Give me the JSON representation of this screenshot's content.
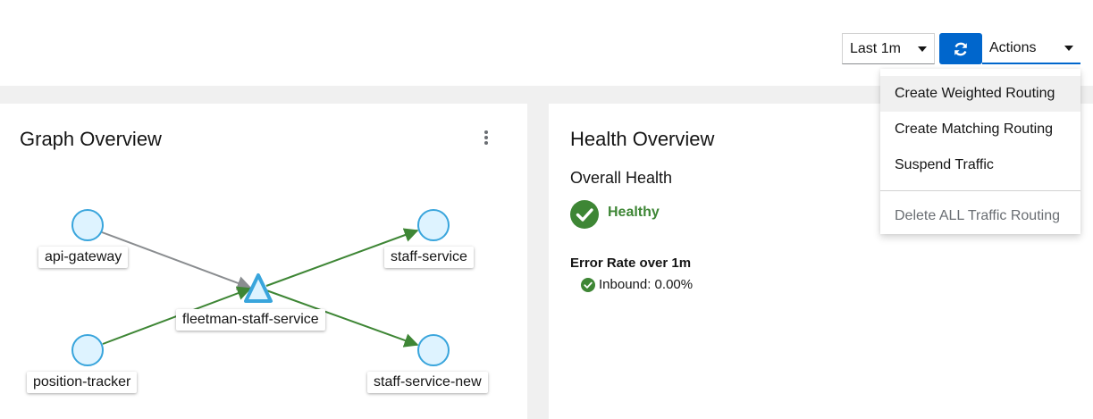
{
  "toolbar": {
    "time_range": "Last 1m",
    "actions_label": "Actions"
  },
  "actions_menu": {
    "items": [
      {
        "label": "Create Weighted Routing"
      },
      {
        "label": "Create Matching Routing"
      },
      {
        "label": "Suspend Traffic"
      },
      {
        "label": "Delete ALL Traffic Routing"
      }
    ]
  },
  "graph_card": {
    "title": "Graph Overview",
    "nodes": {
      "api_gateway": "api-gateway",
      "position_tracker": "position-tracker",
      "fleetman_staff_service": "fleetman-staff-service",
      "staff_service": "staff-service",
      "staff_service_new": "staff-service-new"
    }
  },
  "health_card": {
    "title": "Health Overview",
    "overall_label": "Overall Health",
    "status": "Healthy",
    "error_rate_title": "Error Rate over 1m",
    "inbound": "Inbound: 0.00%"
  },
  "colors": {
    "primary": "#0066cc",
    "healthy_green": "#3e8635",
    "edge_green": "#3e8635",
    "edge_gray": "#8a8d90",
    "node_fill": "#def3ff",
    "node_stroke": "#39a5dc"
  },
  "icons": {
    "refresh": "sync-icon",
    "caret": "caret-down-icon",
    "kebab": "kebab-icon",
    "healthy": "check-circle-icon"
  }
}
